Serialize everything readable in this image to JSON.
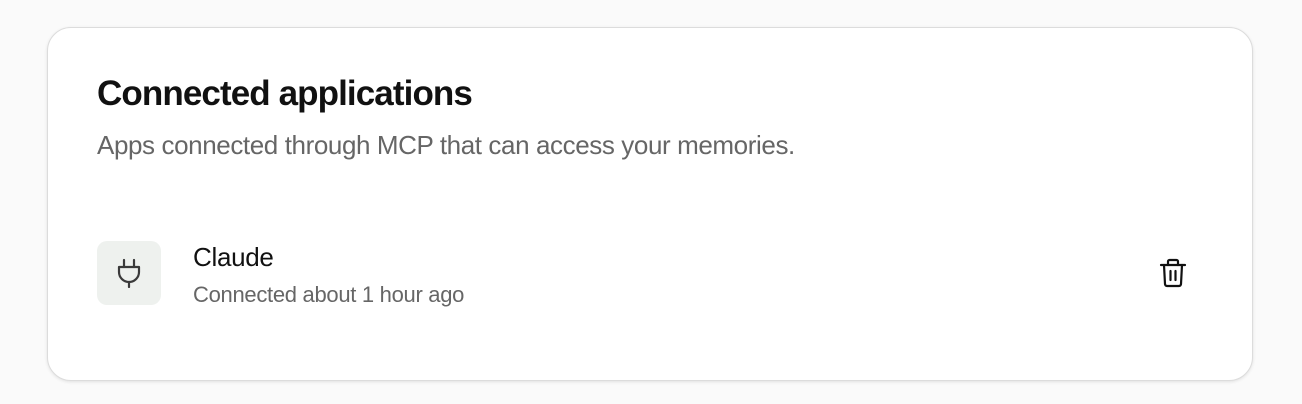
{
  "section": {
    "title": "Connected applications",
    "subtitle": "Apps connected through MCP that can access your memories."
  },
  "apps": [
    {
      "name": "Claude",
      "status": "Connected about 1 hour ago",
      "icon": "plug-icon",
      "action_icon": "trash-icon"
    }
  ]
}
